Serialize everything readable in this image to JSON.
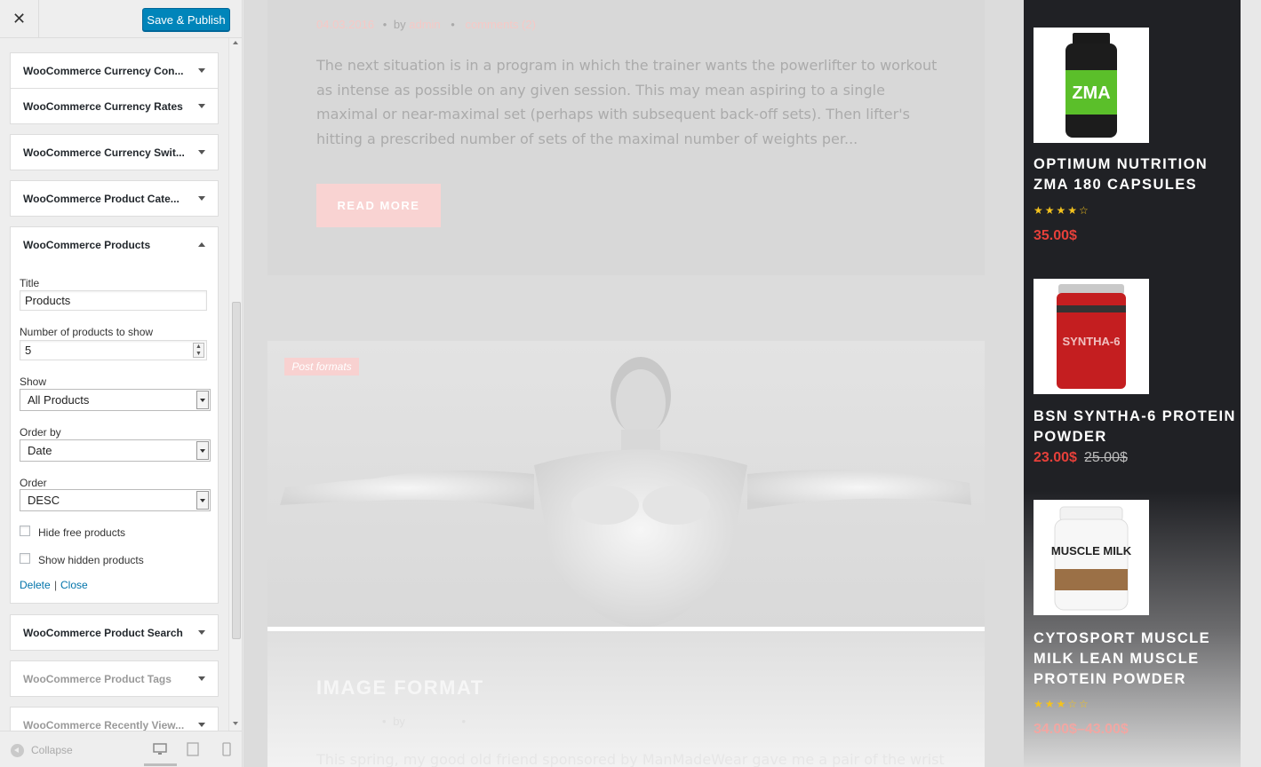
{
  "toolbar": {
    "save_label": "Save & Publish",
    "close_glyph": "✕"
  },
  "sections": [
    {
      "label": "WooCommerce Currency Con..."
    },
    {
      "label": "WooCommerce Currency Rates"
    },
    {
      "label": "WooCommerce Currency Swit..."
    },
    {
      "label": "WooCommerce Product Cate..."
    },
    {
      "label": "WooCommerce Products"
    },
    {
      "label": "WooCommerce Product Search"
    },
    {
      "label": "WooCommerce Product Tags"
    },
    {
      "label": "WooCommerce Recently View..."
    }
  ],
  "widget_form": {
    "title_label": "Title",
    "title_value": "Products",
    "count_label": "Number of products to show",
    "count_value": "5",
    "show_label": "Show",
    "show_value": "All Products",
    "orderby_label": "Order by",
    "orderby_value": "Date",
    "order_label": "Order",
    "order_value": "DESC",
    "hide_free_label": "Hide free products",
    "show_hidden_label": "Show hidden products",
    "delete_label": "Delete",
    "separator": "|",
    "close_label": "Close"
  },
  "footer": {
    "collapse_label": "Collapse"
  },
  "preview": {
    "post1": {
      "date": "04.03.2016",
      "by": "by",
      "author": "admin",
      "comments": "comments (2)",
      "excerpt": "The next situation is in a program in which the trainer wants the powerlifter to workout as intense as possible on any given session. This may mean aspiring to a single maximal or near-maximal set (perhaps with subsequent back-off sets). Then lifter's hitting a prescribed number of sets of the maximal number of weights per...",
      "read_more": "READ MORE"
    },
    "badge": "Post formats",
    "post2": {
      "title": "IMAGE FORMAT",
      "by": "by",
      "excerpt": "This spring, my good old friend sponsored by ManMadeWear gave me a pair of the wrist"
    }
  },
  "products": [
    {
      "title": "OPTIMUM NUTRITION ZMA 180 CAPSULES",
      "rating": "★★★★☆",
      "price": "35.00$",
      "old_price": "",
      "image_label": "ZMA"
    },
    {
      "title": "BSN SYNTHA-6 PROTEIN POWDER",
      "rating": "",
      "price": "23.00$",
      "old_price": "25.00$",
      "image_label": "SYNTHA-6"
    },
    {
      "title": "CYTOSPORT MUSCLE MILK LEAN MUSCLE PROTEIN POWDER",
      "rating": "★★★☆☆",
      "price": "34.00$–43.00$",
      "old_price": "",
      "image_label": "MUSCLE MILK"
    }
  ],
  "colors": {
    "accent": "#0085ba",
    "price": "#e6403a",
    "star": "#f3c21e",
    "widget_bg": "#202125",
    "button_pink": "#f9d3d2"
  }
}
